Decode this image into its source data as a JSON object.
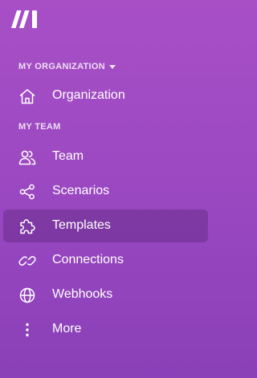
{
  "brand": {
    "logo_icon": "make-logo-icon"
  },
  "sections": {
    "organization": {
      "label": "MY ORGANIZATION",
      "dropdown_icon": "caret-down-icon",
      "items": [
        {
          "label": "Organization",
          "icon": "home-icon"
        }
      ]
    },
    "team": {
      "label": "MY TEAM",
      "items": [
        {
          "label": "Team",
          "icon": "users-icon"
        },
        {
          "label": "Scenarios",
          "icon": "share-nodes-icon"
        },
        {
          "label": "Templates",
          "icon": "puzzle-piece-icon",
          "active": true
        },
        {
          "label": "Connections",
          "icon": "link-icon"
        },
        {
          "label": "Webhooks",
          "icon": "globe-icon"
        },
        {
          "label": "More",
          "icon": "vertical-dots-icon"
        }
      ]
    }
  },
  "colors": {
    "background_top": "#a84fc6",
    "background_bottom": "#8a40b8",
    "active_item": "rgba(60,20,90,0.28)",
    "text": "#ffffff"
  }
}
